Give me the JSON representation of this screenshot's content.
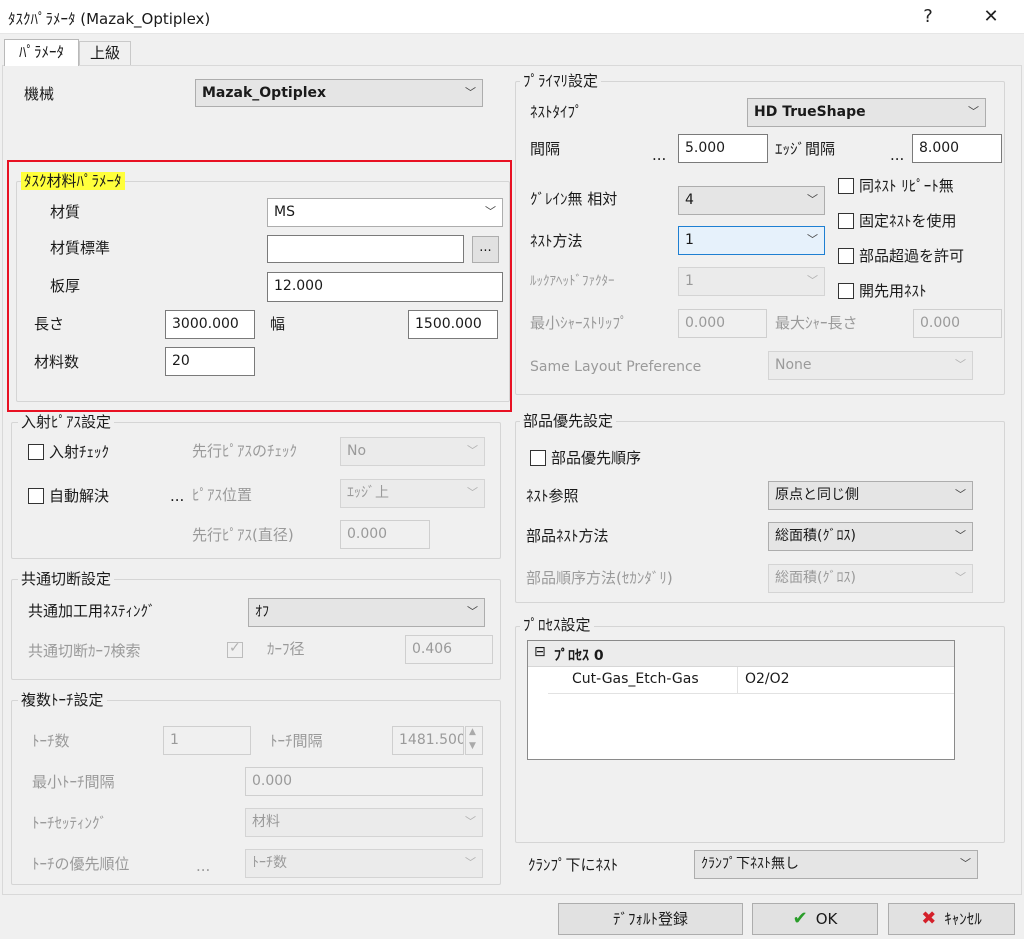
{
  "window": {
    "title": "ﾀｽｸﾊﾟﾗﾒｰﾀ (Mazak_Optiplex)",
    "help_glyph": "?",
    "close_glyph": "✕"
  },
  "tabs": [
    "ﾊﾟﾗﾒｰﾀ",
    "上級"
  ],
  "machine": {
    "label": "機械",
    "value": "Mazak_Optiplex"
  },
  "material": {
    "legend": "ﾀｽｸ材料ﾊﾟﾗﾒｰﾀ",
    "material_label": "材質",
    "material_value": "MS",
    "standard_label": "材質標準",
    "standard_value": "",
    "browse": "...",
    "thickness_label": "板厚",
    "thickness_value": "12.000",
    "length_label": "長さ",
    "length_value": "3000.000",
    "width_label": "幅",
    "width_value": "1500.000",
    "count_label": "材料数",
    "count_value": "20"
  },
  "pierce": {
    "legend": "入射ﾋﾟｱｽ設定",
    "check_label": "入射ﾁｪｯｸ",
    "auto_label": "自動解決",
    "dots": "...",
    "prepierce_check_label": "先行ﾋﾟｱｽのﾁｪｯｸ",
    "prepierce_check_value": "No",
    "position_label": "ﾋﾟｱｽ位置",
    "position_value": "ｴｯｼﾞ上",
    "diameter_label": "先行ﾋﾟｱｽ(直径)",
    "diameter_value": "0.000"
  },
  "common_cut": {
    "legend": "共通切断設定",
    "nesting_label": "共通加工用ﾈｽﾃｨﾝｸﾞ",
    "nesting_value": "ｵﾌ",
    "kerf_search_label": "共通切断ｶｰﾌ検索",
    "kerf_label": "ｶｰﾌ径",
    "kerf_value": "0.406"
  },
  "multi_torch": {
    "legend": "複数ﾄｰﾁ設定",
    "count_label": "ﾄｰﾁ数",
    "count_value": "1",
    "spacing_label": "ﾄｰﾁ間隔",
    "spacing_value": "1481.500",
    "min_spacing_label": "最小ﾄｰﾁ間隔",
    "min_spacing_value": "0.000",
    "setting_label": "ﾄｰﾁｾｯﾃｨﾝｸﾞ",
    "setting_value": "材料",
    "priority_label": "ﾄｰﾁの優先順位",
    "priority_dots": "...",
    "priority_value": "ﾄｰﾁ数"
  },
  "primary": {
    "legend": "ﾌﾟﾗｲﾏﾘ設定",
    "nest_type_label": "ﾈｽﾄﾀｲﾌﾟ",
    "nest_type_value": "HD TrueShape",
    "spacing_label": "間隔",
    "spacing_dots": "...",
    "spacing_value": "5.000",
    "edge_label": "ｴｯｼﾞ間隔",
    "edge_dots": "...",
    "edge_value": "8.000",
    "grain_label": "ｸﾞﾚｲﾝ無 相対",
    "grain_value": "4",
    "method_label": "ﾈｽﾄ方法",
    "method_value": "1",
    "lookahead_label": "ﾙｯｸｱﾍｯﾄﾞﾌｧｸﾀｰ",
    "lookahead_value": "1",
    "min_shear_label": "最小ｼｬｰｽﾄﾘｯﾌﾟ",
    "min_shear_value": "0.000",
    "max_shear_label": "最大ｼｬｰ長さ",
    "max_shear_value": "0.000",
    "same_layout_label": "Same Layout Preference",
    "same_layout_value": "None",
    "chk_no_repeat": "同ﾈｽﾄ ﾘﾋﾟｰﾄ無",
    "chk_fixed": "固定ﾈｽﾄを使用",
    "chk_allow_over": "部品超過を許可",
    "chk_open": "開先用ﾈｽﾄ"
  },
  "part_priority": {
    "legend": "部品優先設定",
    "order_label": "部品優先順序",
    "ref_label": "ﾈｽﾄ参照",
    "ref_value": "原点と同じ側",
    "method_label": "部品ﾈｽﾄ方法",
    "method_value": "総面積(ｸﾞﾛｽ)",
    "order2_label": "部品順序方法(ｾｶﾝﾀﾞﾘ)",
    "order2_value": "総面積(ｸﾞﾛｽ)"
  },
  "process": {
    "legend": "ﾌﾟﾛｾｽ設定",
    "node_toggle": "⊟",
    "node_label": "ﾌﾟﾛｾｽ 0",
    "gas_label": "Cut-Gas_Etch-Gas",
    "gas_value": "O2/O2"
  },
  "clamp": {
    "label": "ｸﾗﾝﾌﾟ下にﾈｽﾄ",
    "value": "ｸﾗﾝﾌﾟ下ﾈｽﾄ無し"
  },
  "buttons": {
    "default": "ﾃﾞﾌｫﾙﾄ登録",
    "ok": "OK",
    "ok_icon": "✔",
    "cancel": "ｷｬﾝｾﾙ",
    "cancel_icon": "✖"
  },
  "colors": {
    "ok_icon": "#2a9d2a",
    "cancel_icon": "#d4202a",
    "highlight": "#ffff3c",
    "red_box": "#e81123"
  }
}
